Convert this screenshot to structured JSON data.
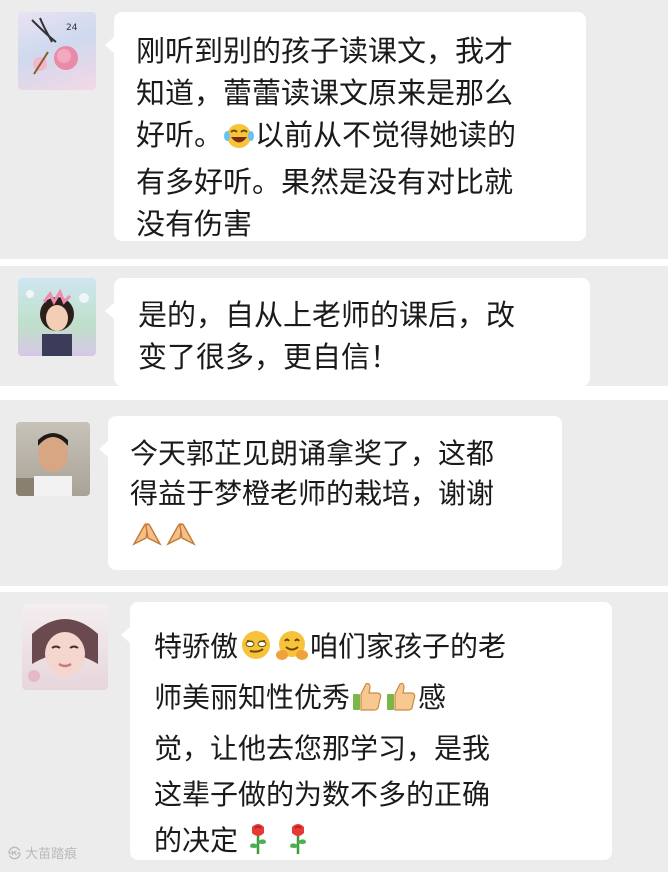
{
  "messages": [
    {
      "text_before_emoji": "刚听到别的孩子读课文，我才\n知道，蕾蕾读课文原来是那么\n好听。",
      "emoji": "face-with-tears-of-joy",
      "text_after_emoji": "以前从不觉得她读的\n有多好听。果然是没有对比就\n没有伤害"
    },
    {
      "text": "是的，自从上老师的课后，改\n变了很多，更自信！"
    },
    {
      "text": "今天郭芷见朗诵拿奖了，这都\n得益于梦橙老师的栽培，谢谢",
      "emojis": [
        "folded-hands",
        "folded-hands"
      ]
    },
    {
      "text_before_emoji": "特骄傲",
      "emojis_inline": [
        "smirking-face",
        "hugging-face"
      ],
      "text_middle": "咱们家孩子的老\n师美丽知性优秀",
      "emojis_thumbs": [
        "thumbs-up",
        "thumbs-up"
      ],
      "text_after_emoji": "感\n觉，让他去您那学习，是我\n这辈子做的为数不多的正确\n的决定",
      "emojis_end": [
        "rose",
        "rose"
      ]
    }
  ],
  "watermark": "大苗踏痕"
}
